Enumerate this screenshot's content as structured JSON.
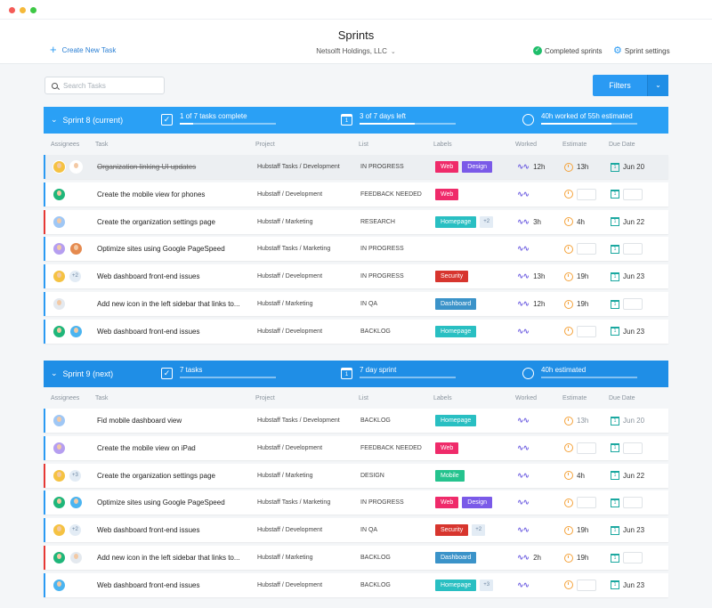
{
  "window": {
    "dot_colors": [
      "#f45b57",
      "#f5b93a",
      "#3ec845"
    ]
  },
  "header": {
    "title": "Sprints",
    "organization": "Netsolft Holdings, LLC",
    "create_task": "Create New Task",
    "completed_sprints": "Completed sprints",
    "sprint_settings": "Sprint settings"
  },
  "search": {
    "placeholder": "Search Tasks"
  },
  "filters": {
    "label": "Filters"
  },
  "columns": [
    "Assignees",
    "Task",
    "Project",
    "List",
    "Labels",
    "Worked",
    "Estimate",
    "Due Date"
  ],
  "label_colors": {
    "Web": "#ef2b6a",
    "Design": "#7a5ae8",
    "Homepage": "#29bfc2",
    "Security": "#d7352e",
    "Dashboard": "#3b93c9",
    "Mobile": "#25c38e"
  },
  "sprints": [
    {
      "title": "Sprint 8 (current)",
      "color": "#2aa0f5",
      "tasks_text": "1 of 7 tasks complete",
      "tasks_progress": 0.14,
      "days_text": "3 of 7 days left",
      "days_progress": 0.57,
      "hours_text": "40h worked of 55h estimated",
      "hours_progress": 0.73,
      "rows": [
        {
          "assignees": [
            "#f5c242",
            "#ffffff"
          ],
          "more": "",
          "task": "Organization linking UI updates",
          "done": true,
          "project": "Hubstaff Tasks / Development",
          "list": "IN PROGRESS",
          "labels": [
            "Web",
            "Design"
          ],
          "labels_more": "",
          "worked": "12h",
          "estimate": "13h",
          "due": "Jun 20",
          "accent": "blue"
        },
        {
          "assignees": [
            "#1fb67a"
          ],
          "more": "",
          "task": "Create the mobile view for phones",
          "done": false,
          "project": "Hubstaff / Development",
          "list": "FEEDBACK NEEDED",
          "labels": [
            "Web"
          ],
          "labels_more": "",
          "worked": "",
          "estimate": "",
          "due": "",
          "accent": "blue"
        },
        {
          "assignees": [
            "#9fc7f5"
          ],
          "more": "",
          "task": "Create the organization settings page",
          "done": false,
          "project": "Hubstaff / Marketing",
          "list": "RESEARCH",
          "labels": [
            "Homepage"
          ],
          "labels_more": "+2",
          "worked": "3h",
          "estimate": "4h",
          "due": "Jun 22",
          "accent": "red"
        },
        {
          "assignees": [
            "#b59ef0",
            "#e58a4f"
          ],
          "more": "",
          "task": "Optimize sites using Google PageSpeed",
          "done": false,
          "project": "Hubstaff Tasks / Marketing",
          "list": "IN PROGRESS",
          "labels": [],
          "labels_more": "",
          "worked": "",
          "estimate": "",
          "due": "",
          "accent": "blue"
        },
        {
          "assignees": [
            "#f5c242"
          ],
          "more": "+2",
          "task": "Web dashboard front-end issues",
          "done": false,
          "project": "Hubstaff / Development",
          "list": "IN PROGRESS",
          "labels": [
            "Security"
          ],
          "labels_more": "",
          "worked": "13h",
          "estimate": "19h",
          "due": "Jun 23",
          "accent": "blue"
        },
        {
          "assignees": [
            "#e4e9ef"
          ],
          "more": "",
          "task": "Add new icon in the left sidebar that links to...",
          "done": false,
          "project": "Hubstaff / Marketing",
          "list": "IN QA",
          "labels": [
            "Dashboard"
          ],
          "labels_more": "",
          "worked": "12h",
          "estimate": "19h",
          "due": "",
          "accent": "blue"
        },
        {
          "assignees": [
            "#1fb67a",
            "#4bb4f0"
          ],
          "more": "",
          "task": "Web dashboard front-end issues",
          "done": false,
          "project": "Hubstaff / Development",
          "list": "BACKLOG",
          "labels": [
            "Homepage"
          ],
          "labels_more": "",
          "worked": "",
          "estimate": "",
          "due": "Jun 23",
          "accent": "blue"
        }
      ]
    },
    {
      "title": "Sprint 9 (next)",
      "color": "#1f8ee6",
      "tasks_text": "7 tasks",
      "tasks_progress": 0,
      "days_text": "7 day sprint",
      "days_progress": 0,
      "hours_text": "40h estimated",
      "hours_progress": 0,
      "rows": [
        {
          "assignees": [
            "#9fc7f5"
          ],
          "more": "",
          "task": "Fid mobile dashboard view",
          "done": false,
          "project": "Hubstaff Tasks / Development",
          "list": "BACKLOG",
          "labels": [
            "Homepage"
          ],
          "labels_more": "",
          "worked": "",
          "estimate": "13h",
          "due": "Jun 20",
          "accent": "blue",
          "muted": true
        },
        {
          "assignees": [
            "#b59ef0"
          ],
          "more": "",
          "task": "Create the mobile view on iPad",
          "done": false,
          "project": "Hubstaff / Development",
          "list": "FEEDBACK NEEDED",
          "labels": [
            "Web"
          ],
          "labels_more": "",
          "worked": "",
          "estimate": "",
          "due": "",
          "accent": "blue"
        },
        {
          "assignees": [
            "#f5c242"
          ],
          "more": "+3",
          "task": "Create the organization settings page",
          "done": false,
          "project": "Hubstaff / Marketing",
          "list": "DESIGN",
          "labels": [
            "Mobile"
          ],
          "labels_more": "",
          "worked": "",
          "estimate": "4h",
          "due": "Jun 22",
          "accent": "red"
        },
        {
          "assignees": [
            "#1fb67a",
            "#4bb4f0"
          ],
          "more": "",
          "task": "Optimize sites using Google PageSpeed",
          "done": false,
          "project": "Hubstaff Tasks / Marketing",
          "list": "IN PROGRESS",
          "labels": [
            "Web",
            "Design"
          ],
          "labels_more": "",
          "worked": "",
          "estimate": "",
          "due": "",
          "accent": "blue"
        },
        {
          "assignees": [
            "#f5c242"
          ],
          "more": "+2",
          "task": "Web dashboard front-end issues",
          "done": false,
          "project": "Hubstaff / Development",
          "list": "IN QA",
          "labels": [
            "Security"
          ],
          "labels_more": "+2",
          "worked": "",
          "estimate": "19h",
          "due": "Jun 23",
          "accent": "blue"
        },
        {
          "assignees": [
            "#1fb67a",
            "#e4e9ef"
          ],
          "more": "",
          "task": "Add new icon in the left sidebar that links to...",
          "done": false,
          "project": "Hubstaff / Marketing",
          "list": "BACKLOG",
          "labels": [
            "Dashboard"
          ],
          "labels_more": "",
          "worked": "2h",
          "estimate": "19h",
          "due": "",
          "accent": "red"
        },
        {
          "assignees": [
            "#4bb4f0"
          ],
          "more": "",
          "task": "Web dashboard front-end issues",
          "done": false,
          "project": "Hubstaff / Development",
          "list": "BACKLOG",
          "labels": [
            "Homepage"
          ],
          "labels_more": "+3",
          "worked": "",
          "estimate": "",
          "due": "Jun 23",
          "accent": "blue"
        }
      ]
    }
  ]
}
